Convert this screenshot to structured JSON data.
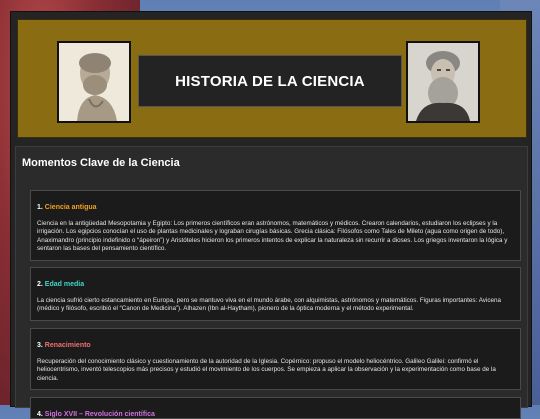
{
  "header": {
    "title": "HISTORIA DE LA CIENCIA"
  },
  "main": {
    "heading": "Momentos Clave de la Ciencia",
    "cards": [
      {
        "num": "1.",
        "title": "Ciencia antigua",
        "title_color": "#f0a020",
        "body": "Ciencia en la antigüedad Mesopotamia y Egipto: Los primeros científicos eran astrónomos, matemáticos y médicos. Crearon calendarios, estudiaron los eclipses y la irrigación. Los egipcios conocían el uso de plantas medicinales y lograban cirugías básicas. Grecia clásica: Filósofos como Tales de Mileto (agua como origen de todo), Anaximandro (principio indefinido o “ápeiron”) y Aristóteles hicieron los primeros intentos de explicar la naturaleza sin recurrir a dioses. Los griegos inventaron la lógica y sentaron las bases del pensamiento científico."
      },
      {
        "num": "2.",
        "title": "Edad media",
        "title_color": "#44d4c8",
        "body": "La ciencia sufrió cierto estancamiento en Europa, pero se mantuvo viva en el mundo árabe, con alquimistas, astrónomos y matemáticos. Figuras importantes: Avicena (médico y filósofo, escribió el “Canon de Medicina”). Alhazen (Ibn al-Haytham), pionero de la óptica moderna y el método experimental."
      },
      {
        "num": "3.",
        "title": "Renacimiento",
        "title_color": "#f07070",
        "body": "Recuperación del conocimiento clásico y cuestionamiento de la autoridad de la Iglesia. Copérnico: propuso el modelo heliocéntrico. Galileo Galilei: confirmó el heliocentrismo, inventó telescopios más precisos y estudió el movimiento de los cuerpos. Se empieza a aplicar la observación y la experimentación como base de la ciencia."
      },
      {
        "num": "4.",
        "title": "Siglo XVII – Revolución científica",
        "title_color": "#d070e0",
        "body": ""
      }
    ]
  }
}
